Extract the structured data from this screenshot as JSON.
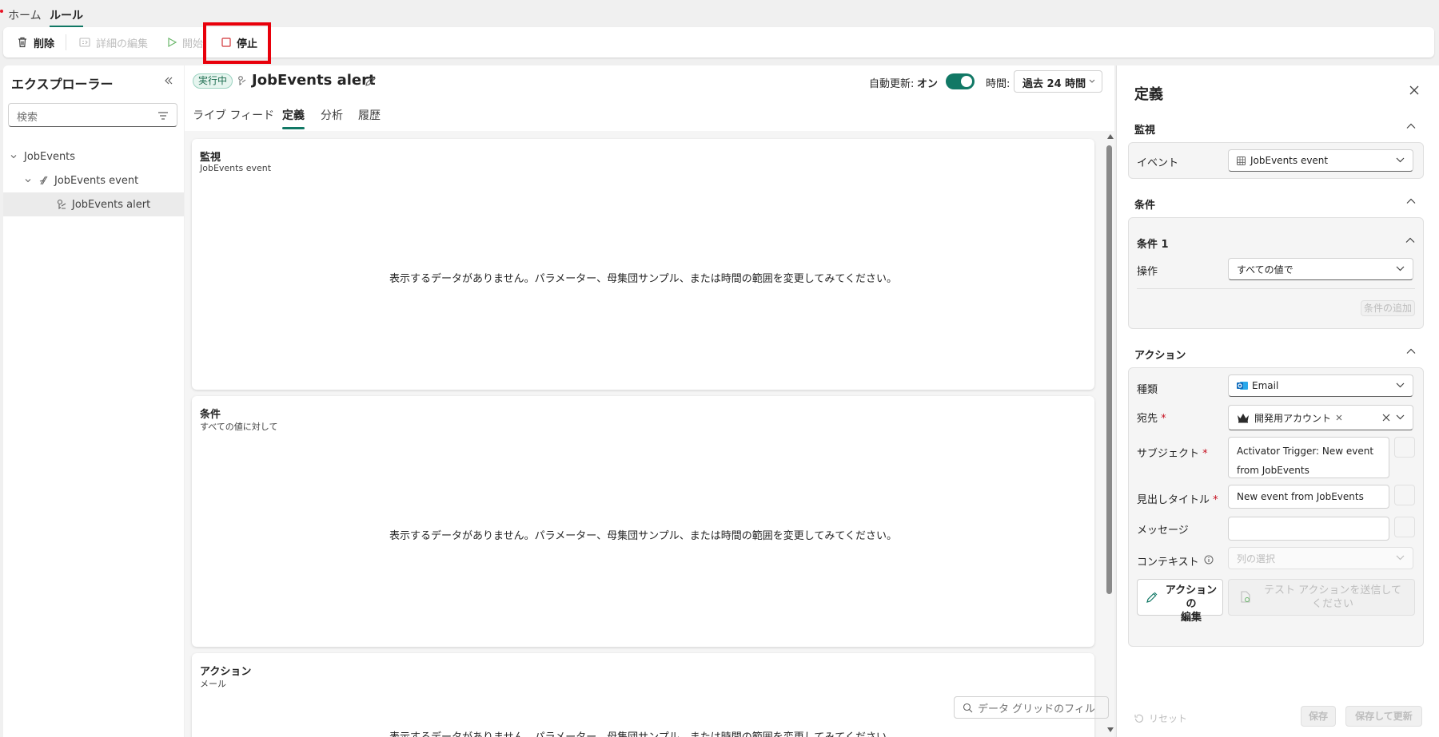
{
  "top_tabs": {
    "home": "ホーム",
    "rule": "ルール"
  },
  "toolbar": {
    "delete": "削除",
    "edit_details": "詳細の編集",
    "start": "開始",
    "stop": "停止"
  },
  "explorer": {
    "title": "エクスプローラー",
    "search_placeholder": "検索",
    "tree": [
      "JobEvents",
      "JobEvents event",
      "JobEvents alert"
    ]
  },
  "header": {
    "status": "実行中",
    "title": "JobEvents alert",
    "auto_refresh_label": "自動更新:",
    "auto_refresh_value": "オン",
    "time_label": "時間:",
    "time_value": "過去 24 時間"
  },
  "tabs": [
    "ライブ フィード",
    "定義",
    "分析",
    "履歴"
  ],
  "cards": {
    "monitor": {
      "title": "監視",
      "subtitle": "JobEvents event"
    },
    "condition": {
      "title": "条件",
      "subtitle": "すべての値に対して"
    },
    "action": {
      "title": "アクション",
      "subtitle": "メール"
    },
    "empty_message": "表示するデータがありません。パラメーター、母集団サンプル、または時間の範囲を変更してみてください。",
    "grid_filter_placeholder": "データ グリッドのフィル"
  },
  "definition": {
    "title": "定義",
    "monitor_section": "監視",
    "event_label": "イベント",
    "event_value": "JobEvents event",
    "condition_section": "条件",
    "condition1": "条件 1",
    "operation_label": "操作",
    "operation_value": "すべての値で",
    "add_condition": "条件の追加",
    "action_section": "アクション",
    "type_label": "種類",
    "type_value": "Email",
    "to_label": "宛先",
    "to_value": "開発用アカウント",
    "subject_label": "サブジェクト",
    "subject_line1": "Activator Trigger: New event",
    "subject_line2": "from JobEvents",
    "headline_label": "見出しタイトル",
    "headline_value": "New event from JobEvents",
    "message_label": "メッセージ",
    "context_label": "コンテキスト",
    "context_placeholder": "列の選択",
    "edit_action_line1": "アクションの",
    "edit_action_line2": "編集",
    "send_test_line1": "テスト アクションを送信して",
    "send_test_line2": "ください",
    "reset": "リセット",
    "save": "保存",
    "save_update": "保存して更新"
  },
  "colors": {
    "accent": "#117865",
    "highlight": "#e8000b",
    "required": "#c50f1f"
  }
}
